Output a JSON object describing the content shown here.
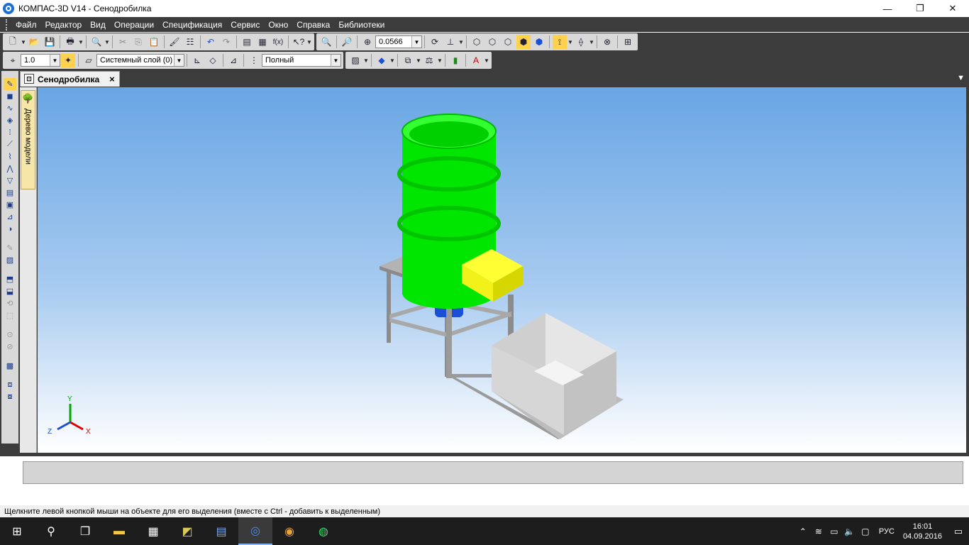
{
  "window": {
    "title": "КОМПАС-3D V14 - Сенодробилка",
    "minimize": "—",
    "maximize": "❐",
    "close": "✕"
  },
  "menu": [
    "Файл",
    "Редактор",
    "Вид",
    "Операции",
    "Спецификация",
    "Сервис",
    "Окно",
    "Справка",
    "Библиотеки"
  ],
  "toolbar": {
    "zoom_value": "0.0566",
    "step_value": "1.0",
    "layer_value": "Системный слой (0)",
    "view_mode": "Полный"
  },
  "document_tab": {
    "label": "Сенодробилка",
    "close": "×"
  },
  "tree_panel": {
    "label": "Дерево модели"
  },
  "axes": {
    "x": "X",
    "y": "Y",
    "z": "Z"
  },
  "status_text": "Щелкните левой кнопкой мыши на объекте для его выделения (вместе с Ctrl - добавить к выделенным)",
  "taskbar": {
    "language": "РУС",
    "time": "16:01",
    "date": "04.09.2016"
  },
  "colors": {
    "drum": "#00ff00",
    "chute": "#ffff33",
    "frame": "#9a9a9a",
    "motor": "#1a4fd6",
    "bin": "#d6d6d6"
  }
}
